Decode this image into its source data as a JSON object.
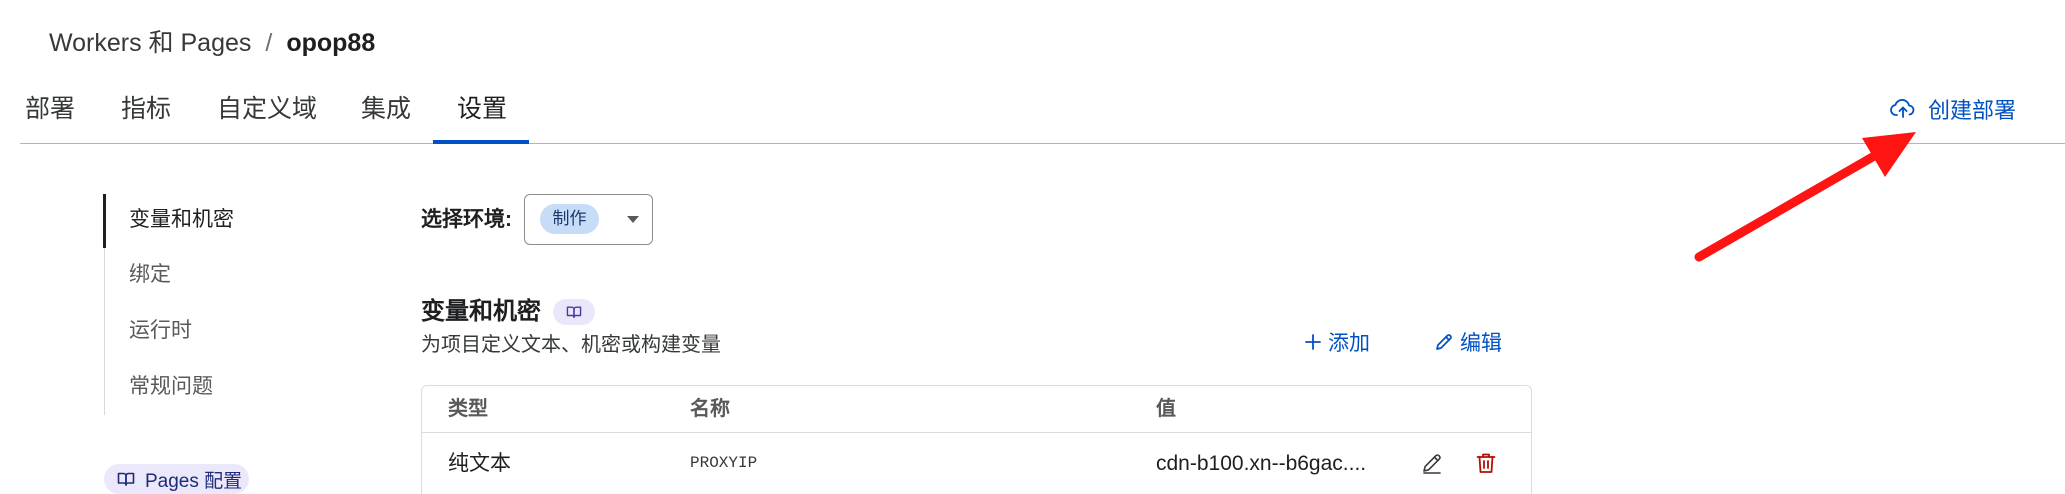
{
  "breadcrumb": {
    "parent": "Workers 和 Pages",
    "separator": "/",
    "current": "opop88"
  },
  "tabs": [
    {
      "label": "部署",
      "active": false
    },
    {
      "label": "指标",
      "active": false
    },
    {
      "label": "自定义域",
      "active": false
    },
    {
      "label": "集成",
      "active": false
    },
    {
      "label": "设置",
      "active": true
    }
  ],
  "header_action": {
    "label": "创建部署",
    "icon": "cloud-upload-icon"
  },
  "sidebar": {
    "items": [
      {
        "label": "变量和机密",
        "active": true
      },
      {
        "label": "绑定",
        "active": false
      },
      {
        "label": "运行时",
        "active": false
      },
      {
        "label": "常规问题",
        "active": false
      }
    ],
    "config_link": {
      "label": "Pages 配置",
      "icon": "book-icon"
    }
  },
  "environment": {
    "label": "选择环境:",
    "selected": "制作"
  },
  "variables": {
    "title": "变量和机密",
    "docs_icon": "book-icon",
    "subtitle": "为项目定义文本、机密或构建变量",
    "add_label": "添加",
    "edit_label": "编辑"
  },
  "table": {
    "columns": [
      "类型",
      "名称",
      "值"
    ],
    "rows": [
      {
        "type": "纯文本",
        "name": "PROXYIP",
        "value": "cdn-b100.xn--b6gac....",
        "actions": [
          "pencil-icon",
          "trash-icon"
        ]
      }
    ]
  },
  "colors": {
    "accent": "#0051c3",
    "danger": "#b20f03",
    "badge_bg": "#c7dcf6",
    "annotation_arrow": "#ff1414"
  }
}
